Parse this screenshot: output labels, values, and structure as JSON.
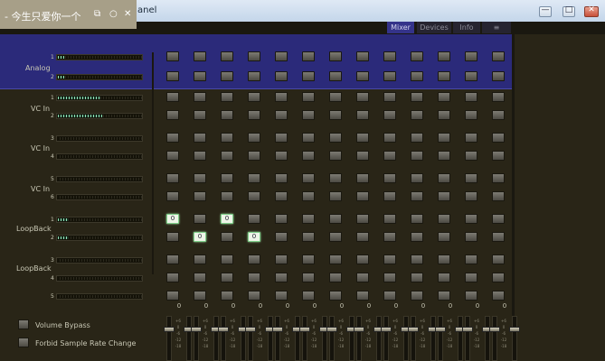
{
  "window": {
    "title": "anel",
    "controls": {
      "minimize": "—",
      "maximize": "□",
      "close": "✕"
    }
  },
  "overlay": {
    "text": "- 今生只爱你一个",
    "icons": [
      "cast-icon",
      "circle-icon",
      "close-icon"
    ]
  },
  "tabs": [
    {
      "label": "Mixer",
      "active": true
    },
    {
      "label": "Devices",
      "active": false
    },
    {
      "label": "Info",
      "active": false
    },
    {
      "label": "≡",
      "active": false
    }
  ],
  "groups": [
    {
      "label": "Analog",
      "channels": [
        {
          "num": "1",
          "level": 0.07
        },
        {
          "num": "2",
          "level": 0.07
        }
      ]
    },
    {
      "label": "VC In",
      "channels": [
        {
          "num": "1",
          "level": 0.5
        },
        {
          "num": "2",
          "level": 0.52
        }
      ]
    },
    {
      "label": "VC In",
      "channels": [
        {
          "num": "3",
          "level": 0
        },
        {
          "num": "4",
          "level": 0
        }
      ]
    },
    {
      "label": "VC In",
      "channels": [
        {
          "num": "5",
          "level": 0
        },
        {
          "num": "6",
          "level": 0
        }
      ]
    },
    {
      "label": "LoopBack",
      "channels": [
        {
          "num": "1",
          "level": 0.13
        },
        {
          "num": "2",
          "level": 0.13
        }
      ]
    },
    {
      "label": "LoopBack",
      "channels": [
        {
          "num": "3",
          "level": 0
        },
        {
          "num": "4",
          "level": 0
        }
      ]
    },
    {
      "label": "",
      "channels": [
        {
          "num": "5",
          "level": 0
        }
      ]
    }
  ],
  "active_cells": [
    {
      "row": 8,
      "col": 0,
      "value": "0"
    },
    {
      "row": 8,
      "col": 2,
      "value": "0"
    },
    {
      "row": 9,
      "col": 1,
      "value": "0"
    },
    {
      "row": 9,
      "col": 3,
      "value": "0"
    }
  ],
  "gain_values": [
    "0",
    "0",
    "0",
    "0",
    "0",
    "0",
    "0",
    "0",
    "0",
    "0",
    "0",
    "0",
    "0"
  ],
  "fader_scale": [
    "+6",
    "0",
    "-6",
    "-12",
    "-18"
  ],
  "options": [
    {
      "label": "Volume Bypass"
    },
    {
      "label": "Forbid Sample Rate Change"
    }
  ],
  "colors": {
    "background": "#292517",
    "analog_band": "#2b2a7a",
    "meter_lit": "#8fe2b6",
    "active_cell": "#eef5e8"
  }
}
